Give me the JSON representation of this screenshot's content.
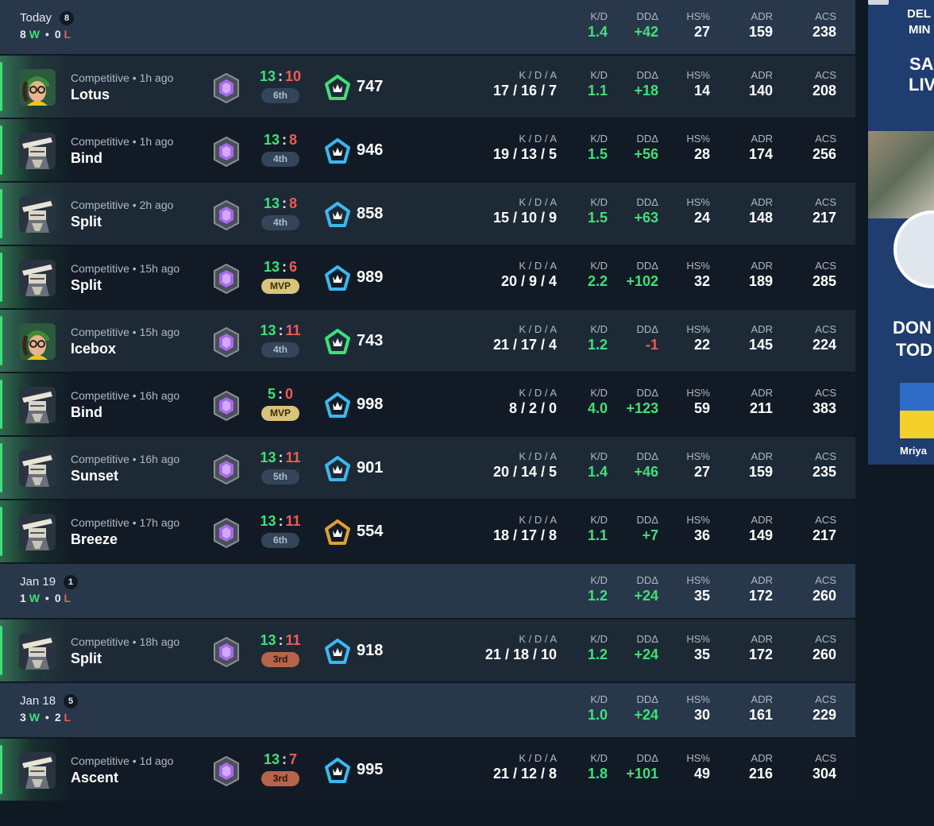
{
  "groups": [
    {
      "title": "Today",
      "count": "8",
      "wins": "8",
      "w": "W",
      "losses": "0",
      "l": "L",
      "stats": {
        "kd": "1.4",
        "dd": "+42",
        "hs": "27",
        "adr": "159",
        "acs": "238"
      },
      "matches": [
        {
          "agent": "killjoy",
          "mode": "Competitive • 1h ago",
          "map": "Lotus",
          "score_a": "13",
          "score_b": "10",
          "place": "6th",
          "place_style": "norm",
          "perf_color": "#3fe07a",
          "perf": "747",
          "kda": "17 / 16 / 7",
          "kd": "1.1",
          "dd": "+18",
          "dd_neg": false,
          "hs": "14",
          "adr": "140",
          "acs": "208"
        },
        {
          "agent": "cypher",
          "mode": "Competitive • 1h ago",
          "map": "Bind",
          "score_a": "13",
          "score_b": "8",
          "place": "4th",
          "place_style": "norm",
          "perf_color": "#3bb8f0",
          "perf": "946",
          "kda": "19 / 13 / 5",
          "kd": "1.5",
          "dd": "+56",
          "dd_neg": false,
          "hs": "28",
          "adr": "174",
          "acs": "256"
        },
        {
          "agent": "cypher",
          "mode": "Competitive • 2h ago",
          "map": "Split",
          "score_a": "13",
          "score_b": "8",
          "place": "4th",
          "place_style": "norm",
          "perf_color": "#3bb8f0",
          "perf": "858",
          "kda": "15 / 10 / 9",
          "kd": "1.5",
          "dd": "+63",
          "dd_neg": false,
          "hs": "24",
          "adr": "148",
          "acs": "217"
        },
        {
          "agent": "cypher",
          "mode": "Competitive • 15h ago",
          "map": "Split",
          "score_a": "13",
          "score_b": "6",
          "place": "MVP",
          "place_style": "mvp",
          "perf_color": "#3bb8f0",
          "perf": "989",
          "kda": "20 / 9 / 4",
          "kd": "2.2",
          "dd": "+102",
          "dd_neg": false,
          "hs": "32",
          "adr": "189",
          "acs": "285"
        },
        {
          "agent": "killjoy",
          "mode": "Competitive • 15h ago",
          "map": "Icebox",
          "score_a": "13",
          "score_b": "11",
          "place": "4th",
          "place_style": "norm",
          "perf_color": "#3fe07a",
          "perf": "743",
          "kda": "21 / 17 / 4",
          "kd": "1.2",
          "dd": "-1",
          "dd_neg": true,
          "hs": "22",
          "adr": "145",
          "acs": "224"
        },
        {
          "agent": "cypher",
          "mode": "Competitive • 16h ago",
          "map": "Bind",
          "score_a": "5",
          "score_b": "0",
          "place": "MVP",
          "place_style": "mvp",
          "perf_color": "#3bb8f0",
          "perf": "998",
          "kda": "8 / 2 / 0",
          "kd": "4.0",
          "dd": "+123",
          "dd_neg": false,
          "hs": "59",
          "adr": "211",
          "acs": "383"
        },
        {
          "agent": "cypher",
          "mode": "Competitive • 16h ago",
          "map": "Sunset",
          "score_a": "13",
          "score_b": "11",
          "place": "5th",
          "place_style": "norm",
          "perf_color": "#3bb8f0",
          "perf": "901",
          "kda": "20 / 14 / 5",
          "kd": "1.4",
          "dd": "+46",
          "dd_neg": false,
          "hs": "27",
          "adr": "159",
          "acs": "235"
        },
        {
          "agent": "cypher",
          "mode": "Competitive • 17h ago",
          "map": "Breeze",
          "score_a": "13",
          "score_b": "11",
          "place": "6th",
          "place_style": "norm",
          "perf_color": "#e0a030",
          "perf": "554",
          "kda": "18 / 17 / 8",
          "kd": "1.1",
          "dd": "+7",
          "dd_neg": false,
          "hs": "36",
          "adr": "149",
          "acs": "217"
        }
      ]
    },
    {
      "title": "Jan 19",
      "count": "1",
      "wins": "1",
      "w": "W",
      "losses": "0",
      "l": "L",
      "stats": {
        "kd": "1.2",
        "dd": "+24",
        "hs": "35",
        "adr": "172",
        "acs": "260"
      },
      "matches": [
        {
          "agent": "cypher",
          "mode": "Competitive • 18h ago",
          "map": "Split",
          "score_a": "13",
          "score_b": "11",
          "place": "3rd",
          "place_style": "bronze",
          "perf_color": "#3bb8f0",
          "perf": "918",
          "kda": "21 / 18 / 10",
          "kd": "1.2",
          "dd": "+24",
          "dd_neg": false,
          "hs": "35",
          "adr": "172",
          "acs": "260"
        }
      ]
    },
    {
      "title": "Jan 18",
      "count": "5",
      "wins": "3",
      "w": "W",
      "losses": "2",
      "l": "L",
      "stats": {
        "kd": "1.0",
        "dd": "+24",
        "hs": "30",
        "adr": "161",
        "acs": "229"
      },
      "matches": [
        {
          "agent": "cypher",
          "mode": "Competitive • 1d ago",
          "map": "Ascent",
          "score_a": "13",
          "score_b": "7",
          "place": "3rd",
          "place_style": "bronze",
          "perf_color": "#3bb8f0",
          "perf": "995",
          "kda": "21 / 12 / 8",
          "kd": "1.8",
          "dd": "+101",
          "dd_neg": false,
          "hs": "49",
          "adr": "216",
          "acs": "304"
        }
      ]
    }
  ],
  "labels": {
    "kda": "K / D / A",
    "kd": "K/D",
    "dd": "DDΔ",
    "hs": "HS%",
    "adr": "ADR",
    "acs": "ACS"
  },
  "ad": {
    "lines": [
      "DEL",
      "MIN",
      "SA",
      "LIV",
      "DON",
      "TOD",
      "Mriya"
    ]
  }
}
